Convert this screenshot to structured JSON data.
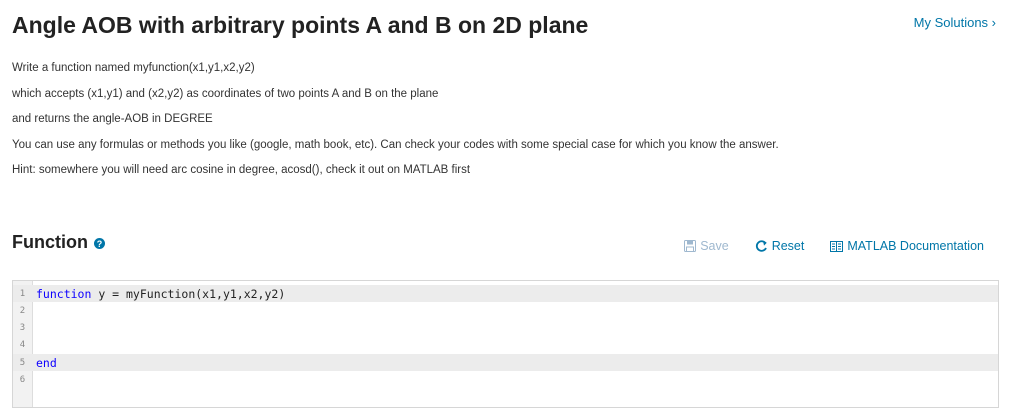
{
  "page": {
    "title": "Angle AOB with arbitrary points A and B on 2D plane",
    "my_solutions": "My Solutions ›"
  },
  "description": [
    "Write a function named myfunction(x1,y1,x2,y2)",
    "which accepts (x1,y1) and (x2,y2) as coordinates of two points A and B on the plane",
    "and returns the angle-AOB in DEGREE",
    "You can use any formulas or methods you like (google, math book, etc). Can check your codes with some special case for which you know the answer.",
    "Hint: somewhere you will need arc cosine in degree, acosd(), check it out on MATLAB first"
  ],
  "function_section": {
    "heading": "Function",
    "help_icon": "help-icon",
    "save_label": "Save",
    "reset_label": "Reset",
    "docs_label": "MATLAB Documentation"
  },
  "editor": {
    "lines": [
      {
        "num": "1",
        "keyword": "function",
        "text": " y = myFunction(x1,y1,x2,y2)"
      },
      {
        "num": "2",
        "keyword": "",
        "text": ""
      },
      {
        "num": "3",
        "keyword": "",
        "text": ""
      },
      {
        "num": "4",
        "keyword": "",
        "text": ""
      },
      {
        "num": "5",
        "keyword": "end",
        "text": ""
      },
      {
        "num": "6",
        "keyword": "",
        "text": ""
      }
    ]
  },
  "colors": {
    "link": "#0076a8",
    "disabled": "#9fb8cf",
    "keyword": "#0e00ff"
  }
}
